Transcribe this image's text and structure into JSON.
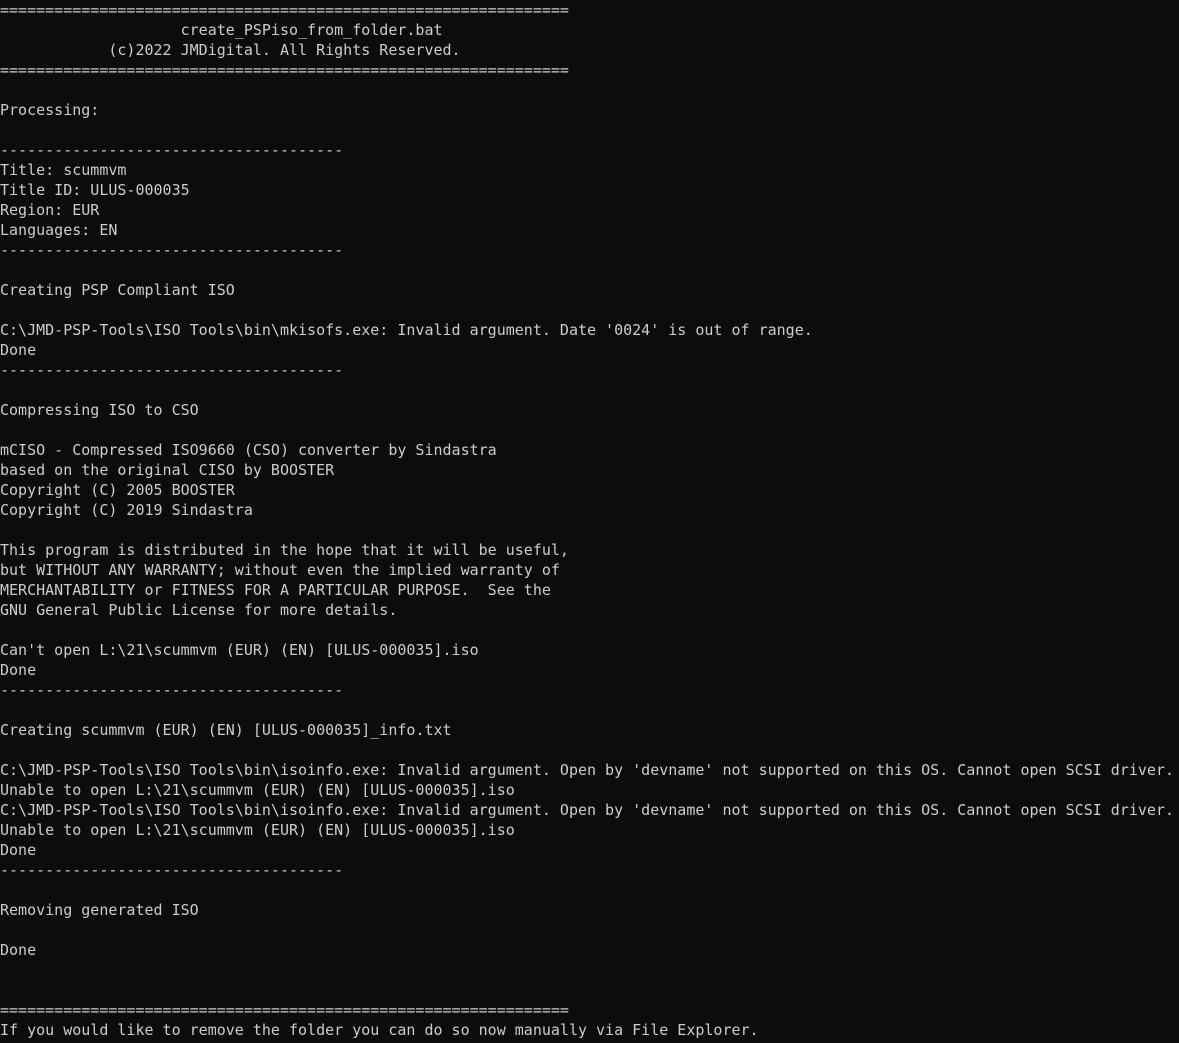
{
  "window": {
    "type": "console",
    "background": "#0c0c0c",
    "foreground": "#cccccc"
  },
  "lines": [
    "===============================================================",
    "                    create_PSPiso_from_folder.bat",
    "            (c)2022 JMDigital. All Rights Reserved.",
    "===============================================================",
    "",
    "Processing:",
    "",
    "--------------------------------------",
    "Title: scummvm",
    "Title ID: ULUS-000035",
    "Region: EUR",
    "Languages: EN",
    "--------------------------------------",
    "",
    "Creating PSP Compliant ISO",
    "",
    "C:\\JMD-PSP-Tools\\ISO Tools\\bin\\mkisofs.exe: Invalid argument. Date '0024' is out of range.",
    "Done",
    "--------------------------------------",
    "",
    "Compressing ISO to CSO",
    "",
    "mCISO - Compressed ISO9660 (CSO) converter by Sindastra",
    "based on the original CISO by BOOSTER",
    "Copyright (C) 2005 BOOSTER",
    "Copyright (C) 2019 Sindastra",
    "",
    "This program is distributed in the hope that it will be useful,",
    "but WITHOUT ANY WARRANTY; without even the implied warranty of",
    "MERCHANTABILITY or FITNESS FOR A PARTICULAR PURPOSE.  See the",
    "GNU General Public License for more details.",
    "",
    "Can't open L:\\21\\scummvm (EUR) (EN) [ULUS-000035].iso",
    "Done",
    "--------------------------------------",
    "",
    "Creating scummvm (EUR) (EN) [ULUS-000035]_info.txt",
    "",
    "C:\\JMD-PSP-Tools\\ISO Tools\\bin\\isoinfo.exe: Invalid argument. Open by 'devname' not supported on this OS. Cannot open SCSI driver.",
    "Unable to open L:\\21\\scummvm (EUR) (EN) [ULUS-000035].iso",
    "C:\\JMD-PSP-Tools\\ISO Tools\\bin\\isoinfo.exe: Invalid argument. Open by 'devname' not supported on this OS. Cannot open SCSI driver.",
    "Unable to open L:\\21\\scummvm (EUR) (EN) [ULUS-000035].iso",
    "Done",
    "--------------------------------------",
    "",
    "Removing generated ISO",
    "",
    "Done",
    "",
    "",
    "===============================================================",
    "If you would like to remove the folder you can do so now manually via File Explorer."
  ]
}
